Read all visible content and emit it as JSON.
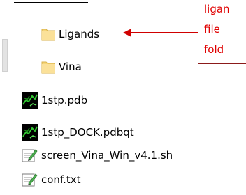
{
  "files": [
    {
      "name": "Ligands",
      "type": "folder"
    },
    {
      "name": "Vina",
      "type": "folder"
    },
    {
      "name": "1stp.pdb",
      "type": "pdb-file"
    },
    {
      "name": "1stp_DOCK.pdbqt",
      "type": "pdb-file"
    },
    {
      "name": "screen_Vina_Win_v4.1.sh",
      "type": "text-file"
    },
    {
      "name": "conf.txt",
      "type": "text-file"
    }
  ],
  "callout": {
    "lines": [
      "ligan",
      "file",
      "fold"
    ]
  },
  "icons": {
    "folder": "folder-icon",
    "pdb": "molecule-file-icon",
    "text": "text-document-icon"
  },
  "colors": {
    "callout_text": "#e00000",
    "callout_border": "#8b1a1a",
    "arrow": "#d00000",
    "folder_fill": "#f6d67a"
  }
}
